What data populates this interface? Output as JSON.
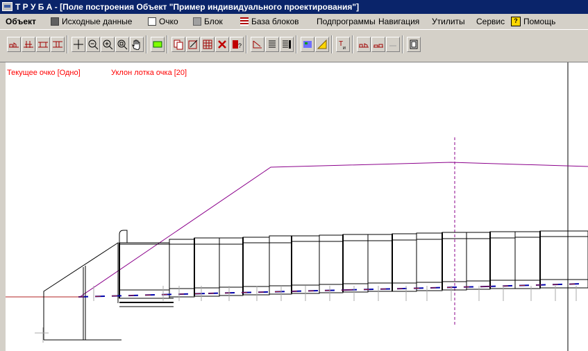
{
  "window": {
    "title": "Т Р У Б А - [Поле построения  Объект \"Пример индивидуального проектирования\"]"
  },
  "menu": {
    "items": [
      {
        "label": "Объект",
        "bold": true
      },
      {
        "label": "Исходные данные",
        "icon": "database-icon"
      },
      {
        "label": "Очко",
        "icon": "pipe-section-icon"
      },
      {
        "label": "Блок",
        "icon": "block-icon"
      },
      {
        "label": "База блоков",
        "icon": "list-icon"
      },
      {
        "label": "Подпрограммы"
      },
      {
        "label": "Навигация"
      },
      {
        "label": "Утилиты"
      },
      {
        "label": "Сервис"
      },
      {
        "label": "Помощь",
        "icon": "help-icon"
      }
    ]
  },
  "toolbar": {
    "buttons": [
      {
        "name": "profile-view-icon"
      },
      {
        "name": "section-view-icon"
      },
      {
        "name": "plan-view-icon"
      },
      {
        "name": "front-view-icon"
      },
      {
        "name": "crosshair-icon"
      },
      {
        "name": "zoom-out-icon"
      },
      {
        "name": "zoom-in-icon"
      },
      {
        "name": "zoom-window-icon"
      },
      {
        "name": "pan-hand-icon"
      },
      {
        "name": "block-insert-icon"
      },
      {
        "name": "copy-block-icon"
      },
      {
        "name": "edit-block-icon"
      },
      {
        "name": "grid-icon"
      },
      {
        "name": "delete-icon"
      },
      {
        "name": "block-info-icon"
      },
      {
        "name": "slope-icon"
      },
      {
        "name": "list-view-icon"
      },
      {
        "name": "table-icon"
      },
      {
        "name": "colored-map-icon"
      },
      {
        "name": "ruler-icon"
      },
      {
        "name": "text-edit-icon"
      },
      {
        "name": "road-profile-icon"
      },
      {
        "name": "road-section-icon"
      },
      {
        "name": "disabled-icon"
      },
      {
        "name": "page-icon"
      }
    ]
  },
  "canvas": {
    "current_section": "Текущее очко [Одно]",
    "slope": "Уклон лотка очка [20]"
  },
  "colors": {
    "title_bg": "#0a246a",
    "label_red": "#ff0000",
    "embankment": "#8b008b",
    "tray_blue": "#0000aa"
  }
}
